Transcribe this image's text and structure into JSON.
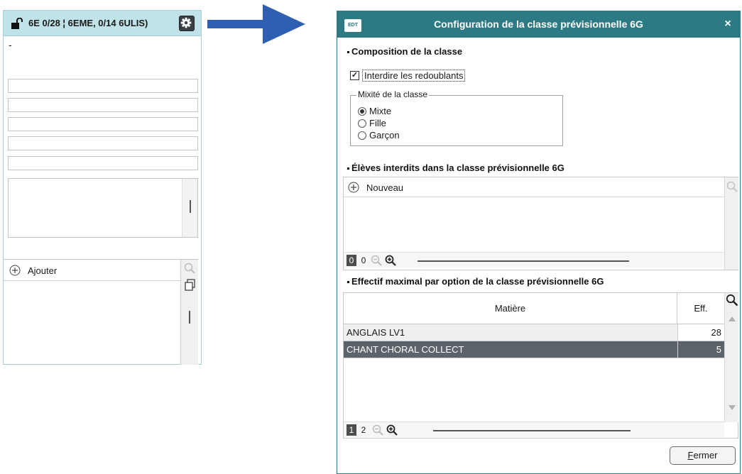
{
  "left_panel": {
    "title": "6E 0/28 ¦ 6EME, 0/14 6ULIS)",
    "dash": "-",
    "add_label": "Ajouter"
  },
  "dialog": {
    "logo_text": "EDT",
    "title": "Configuration de la classe prévisionnelle 6G",
    "close_glyph": "×",
    "section_composition": "Composition de la classe",
    "checkbox_label": "Interdire les redoublants",
    "checkbox_checked": true,
    "mixite": {
      "legend": "Mixité de la classe",
      "options": [
        "Mixte",
        "Fille",
        "Garçon"
      ],
      "selected": "Mixte"
    },
    "section_eleves": "Élèves interdits dans la classe prévisionnelle 6G",
    "new_label": "Nouveau",
    "eleves_pager": {
      "p1": "0",
      "p2": "0"
    },
    "section_effectif": "Effectif maximal par option de la classe prévisionnelle 6G",
    "table": {
      "col_matiere": "Matière",
      "col_eff": "Eff.",
      "rows": [
        {
          "matiere": "ANGLAIS LV1",
          "eff": "28"
        },
        {
          "matiere": "CHANT CHORAL COLLECT",
          "eff": "5"
        }
      ]
    },
    "table_pager": {
      "p1": "1",
      "p2": "2"
    },
    "close_button_first": "F",
    "close_button_rest": "ermer"
  },
  "colors": {
    "titlebar": "#2b7a84",
    "left_header": "#bfe3e8",
    "arrow": "#2e5fb0",
    "selected_row": "#5d636a"
  }
}
